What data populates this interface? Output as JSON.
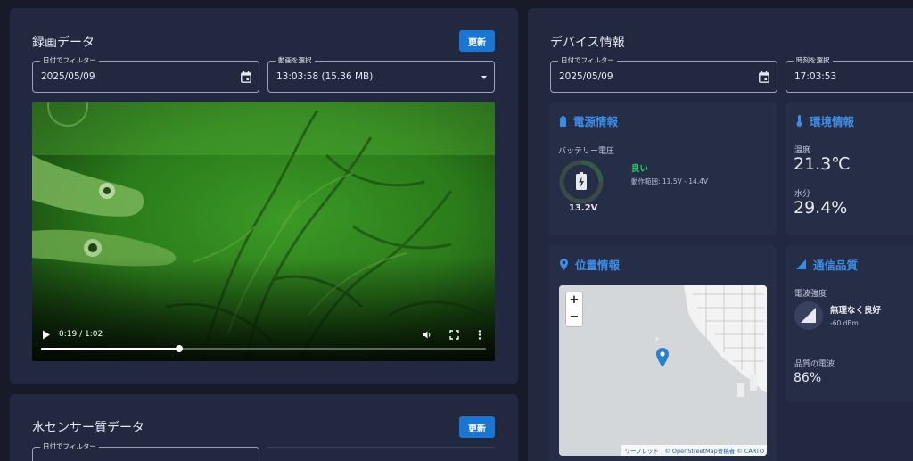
{
  "recording": {
    "title": "録画データ",
    "refresh_label": "更新",
    "date_filter": {
      "label": "日付でフィルター",
      "value": "2025/05/09"
    },
    "video_select": {
      "label": "動画を選択",
      "value": "13:03:58 (15.36 MB)"
    },
    "video": {
      "time": "0:19 / 1:02",
      "progress": 0.31
    }
  },
  "water": {
    "title": "水センサー質データ",
    "refresh_label": "更新",
    "date_filter": {
      "label": "日付でフィルター"
    }
  },
  "device": {
    "title": "デバイス情報",
    "date_filter": {
      "label": "日付でフィルター",
      "value": "2025/05/09"
    },
    "time_select": {
      "label": "時刻を選択",
      "value": "17:03:53"
    },
    "power": {
      "title": "電源情報",
      "battery_label": "バッテリー電圧",
      "voltage": "13.2V",
      "status": "良い",
      "range": "動作範囲: 11.5V - 14.4V",
      "status_color": "#22d36b"
    },
    "environment": {
      "title": "環境情報",
      "temp_label": "温度",
      "temp_value": "21.3℃",
      "moisture_label": "水分",
      "moisture_value": "29.4%"
    },
    "location": {
      "title": "位置情報",
      "zoom_in": "+",
      "zoom_out": "−",
      "attribution": "リーフレット | © OpenStreetMap寄稿者 © CARTO"
    },
    "signal": {
      "title": "通信品質",
      "strength_label": "電波強度",
      "strength_status": "無理なく良好",
      "dbm": "-60 dBm",
      "quality_label": "品質の電波",
      "quality_value": "86%"
    }
  },
  "colors": {
    "accent": "#1976d2",
    "title_blue": "#3b8ee8",
    "card": "#222840",
    "bg": "#171b29"
  }
}
